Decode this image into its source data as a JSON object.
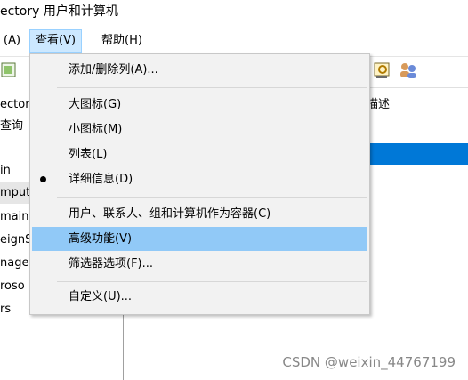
{
  "window": {
    "title": "ectory 用户和计算机"
  },
  "menubar": {
    "items": [
      {
        "label": "(A)"
      },
      {
        "label": "查看(V)"
      },
      {
        "label": "帮助(H)"
      }
    ]
  },
  "tree": {
    "items": [
      {
        "label": "ectory"
      },
      {
        "label": "查询"
      },
      {
        "label": "in"
      },
      {
        "label": "mpute"
      },
      {
        "label": "main"
      },
      {
        "label": "eignS"
      },
      {
        "label": "nage"
      },
      {
        "label": "roso"
      },
      {
        "label": "rs"
      }
    ]
  },
  "content": {
    "description_header": "描述"
  },
  "view_menu": {
    "items": [
      {
        "label": "添加/删除列(A)..."
      },
      {
        "label": "大图标(G)"
      },
      {
        "label": "小图标(M)"
      },
      {
        "label": "列表(L)"
      },
      {
        "label": "详细信息(D)",
        "checked": true
      },
      {
        "label": "用户、联系人、组和计算机作为容器(C)"
      },
      {
        "label": "高级功能(V)",
        "highlighted": true
      },
      {
        "label": "筛选器选项(F)..."
      },
      {
        "label": "自定义(U)..."
      }
    ]
  },
  "watermark": "CSDN @weixin_44767199"
}
